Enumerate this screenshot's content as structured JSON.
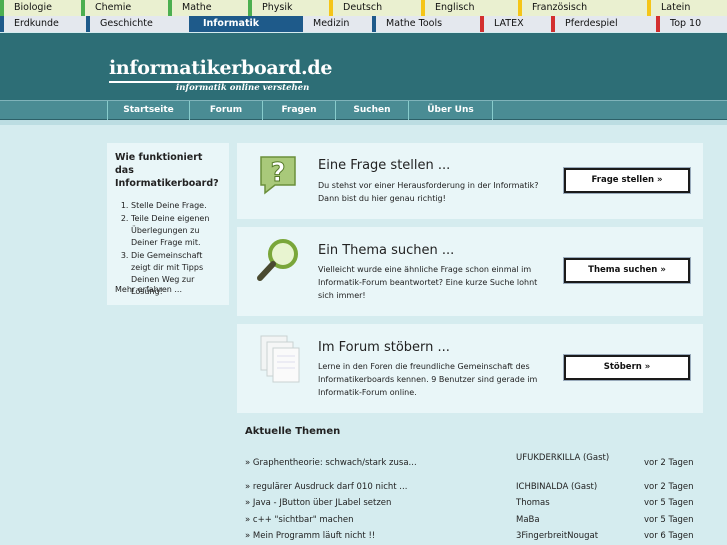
{
  "subjects_row1": [
    {
      "label": "Biologie",
      "color": "#4caf50"
    },
    {
      "label": "Chemie",
      "color": "#4caf50"
    },
    {
      "label": "Mathe",
      "color": "#4caf50"
    },
    {
      "label": "Physik",
      "color": "#4caf50"
    },
    {
      "label": "Deutsch",
      "color": "#f5c518"
    },
    {
      "label": "Englisch",
      "color": "#f5c518"
    },
    {
      "label": "Französisch",
      "color": "#f5c518"
    },
    {
      "label": "Latein",
      "color": "#f5c518"
    }
  ],
  "subjects_row2": [
    {
      "label": "Erdkunde",
      "color": "#1e5a8a"
    },
    {
      "label": "Geschichte",
      "color": "#1e5a8a"
    },
    {
      "label": "Informatik",
      "color": "#1e5a8a",
      "active": true
    },
    {
      "label": "Medizin",
      "color": "#1e5a8a"
    },
    {
      "label": "Mathe Tools",
      "color": "#1e5a8a"
    },
    {
      "label": "LATEX",
      "color": "#d32f2f"
    },
    {
      "label": "Pferdespiel",
      "color": "#d32f2f"
    },
    {
      "label": "Top 10",
      "color": "#d32f2f"
    }
  ],
  "header": {
    "logo": "informatikerboard.de",
    "tagline": "informatik online verstehen"
  },
  "nav": [
    "Startseite",
    "Forum",
    "Fragen",
    "Suchen",
    "Über Uns"
  ],
  "sidebar": {
    "title": "Wie funktioniert das Informatikerboard?",
    "steps": [
      "Stelle Deine Frage.",
      "Teile Deine eigenen Überlegungen zu Deiner Frage mit.",
      "Die Gemeinschaft zeigt dir mit Tipps Deinen Weg zur Lösung!"
    ],
    "more": "Mehr erfahren ..."
  },
  "cards": [
    {
      "title": "Eine Frage stellen ...",
      "text": "Du stehst vor einer Herausforderung in der Informatik? Dann bist du hier genau richtig!",
      "button": "Frage stellen »",
      "icon": "question-icon"
    },
    {
      "title": "Ein Thema suchen ...",
      "text": "Vielleicht wurde eine ähnliche Frage schon einmal im Informatik-Forum beantwortet? Eine kurze Suche lohnt sich immer!",
      "button": "Thema suchen »",
      "icon": "magnifier-icon"
    },
    {
      "title": "Im Forum stöbern ...",
      "text": "Lerne in den Foren die freundliche Gemeinschaft des Informatikerboards kennen. 9 Benutzer sind gerade im Informatik-Forum online.",
      "button": "Stöbern »",
      "icon": "documents-icon"
    }
  ],
  "topics": {
    "title": "Aktuelle Themen",
    "rows": [
      {
        "title": "» Graphentheorie: schwach/stark zusa...",
        "user": "UFUKDERKILLA (Gast)",
        "time": "vor 2 Tagen"
      },
      {
        "title": "» regulärer Ausdruck darf 010 nicht ...",
        "user": "ICHBINALDA (Gast)",
        "time": "vor 2 Tagen"
      },
      {
        "title": "» Java - JButton über JLabel setzen",
        "user": "Thomas",
        "time": "vor 5 Tagen"
      },
      {
        "title": "» c++ \"sichtbar\" machen",
        "user": "MaBa",
        "time": "vor 5 Tagen"
      },
      {
        "title": "» Mein Programm läuft nicht !!",
        "user": "3FingerbreitNougat",
        "time": "vor 6 Tagen"
      }
    ]
  }
}
